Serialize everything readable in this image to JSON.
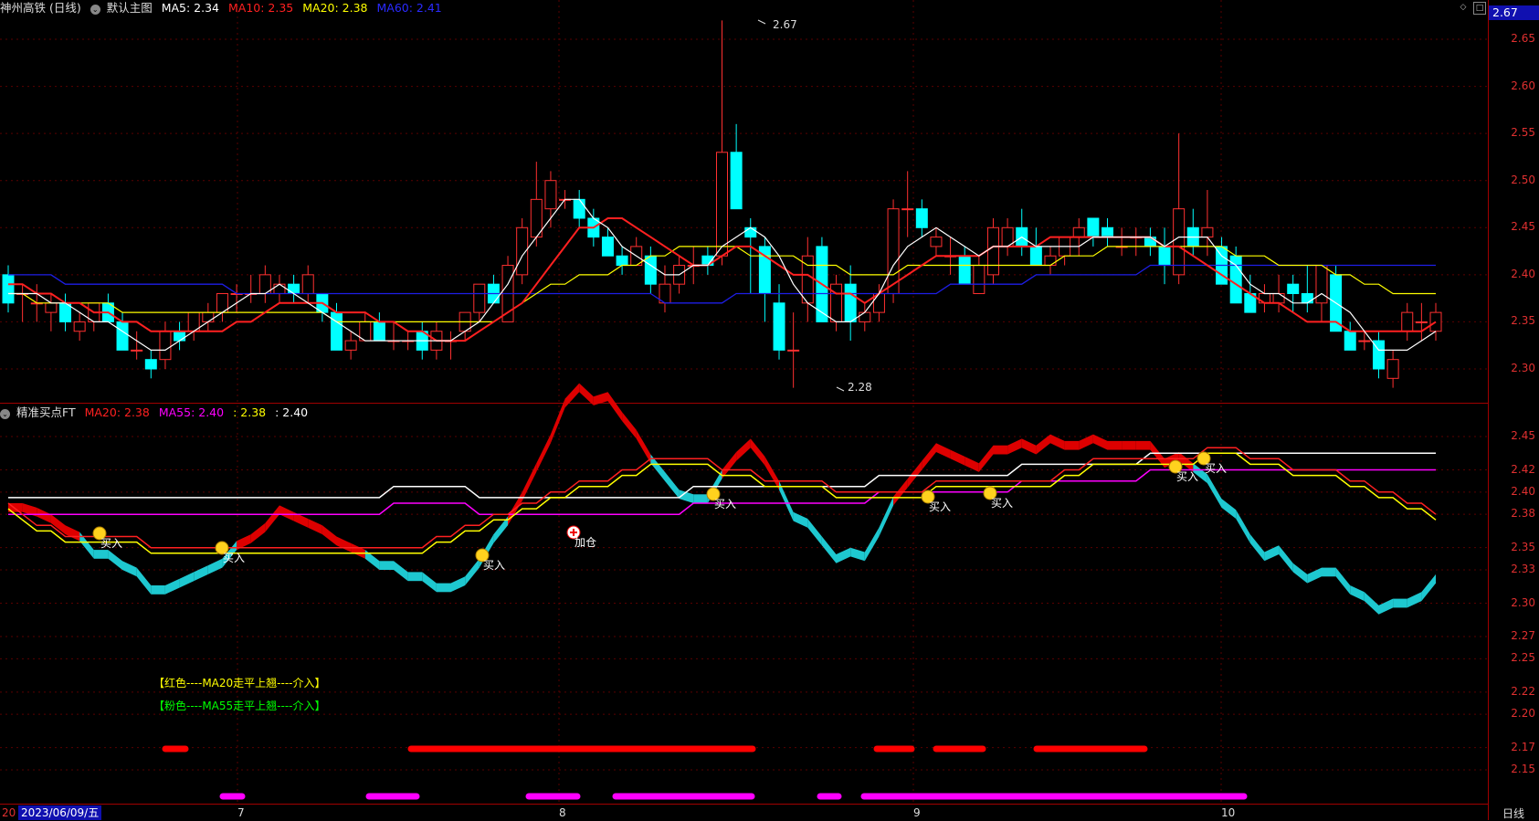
{
  "top_header": {
    "title": "神州高铁 (日线)",
    "main_chart_label": "默认主图",
    "ma5": "MA5: 2.34",
    "ma10": "MA10: 2.35",
    "ma20": "MA20: 2.38",
    "ma60": "MA60: 2.41"
  },
  "sub_header": {
    "title": "精准买点FT",
    "ma20": "MA20: 2.38",
    "ma55": "MA55: 2.40",
    "v3": ": 2.38",
    "v4": ": 2.40"
  },
  "current_price": "2.67",
  "main_axis": [
    "2.65",
    "2.60",
    "2.55",
    "2.50",
    "2.45",
    "2.40",
    "2.35",
    "2.30"
  ],
  "sub_axis": [
    "2.45",
    "2.42",
    "2.40",
    "2.38",
    "2.35",
    "2.33",
    "2.30",
    "2.27",
    "2.25",
    "2.22",
    "2.20",
    "2.17",
    "2.15"
  ],
  "high_marker": "2.67",
  "low_marker": "2.28",
  "signals": [
    "买入",
    "买入",
    "买入",
    "加仓",
    "买入",
    "买入",
    "买入",
    "买入",
    "买入"
  ],
  "legend": {
    "red": "【红色----MA20走平上翘----介入】",
    "pink": "【粉色----MA55走平上翘----介入】"
  },
  "x_axis": {
    "start": "20",
    "current_date": "2023/06/09/五",
    "months": [
      "7",
      "8",
      "9",
      "10"
    ],
    "period": "日线"
  },
  "colors": {
    "up_candle": "#ff3030",
    "down_candle": "#00ffff",
    "ma5": "#ffffff",
    "ma10": "#ff2020",
    "ma20": "#ffff00",
    "ma60": "#1e1ee6",
    "pink": "#ff00ff"
  },
  "chart_data": {
    "type": "candlestick",
    "ohlc": [
      [
        2.4,
        2.41,
        2.36,
        2.37
      ],
      [
        2.38,
        2.39,
        2.35,
        2.38
      ],
      [
        2.37,
        2.39,
        2.35,
        2.37
      ],
      [
        2.36,
        2.38,
        2.34,
        2.37
      ],
      [
        2.37,
        2.38,
        2.34,
        2.35
      ],
      [
        2.34,
        2.36,
        2.33,
        2.35
      ],
      [
        2.35,
        2.37,
        2.34,
        2.37
      ],
      [
        2.37,
        2.38,
        2.35,
        2.35
      ],
      [
        2.35,
        2.36,
        2.32,
        2.32
      ],
      [
        2.32,
        2.34,
        2.31,
        2.32
      ],
      [
        2.31,
        2.32,
        2.29,
        2.3
      ],
      [
        2.31,
        2.35,
        2.3,
        2.34
      ],
      [
        2.34,
        2.35,
        2.32,
        2.33
      ],
      [
        2.34,
        2.36,
        2.33,
        2.36
      ],
      [
        2.35,
        2.37,
        2.34,
        2.36
      ],
      [
        2.36,
        2.38,
        2.35,
        2.38
      ],
      [
        2.38,
        2.39,
        2.36,
        2.38
      ],
      [
        2.38,
        2.4,
        2.37,
        2.38
      ],
      [
        2.38,
        2.41,
        2.37,
        2.4
      ],
      [
        2.38,
        2.4,
        2.37,
        2.39
      ],
      [
        2.39,
        2.4,
        2.37,
        2.38
      ],
      [
        2.38,
        2.41,
        2.37,
        2.4
      ],
      [
        2.38,
        2.38,
        2.35,
        2.36
      ],
      [
        2.36,
        2.37,
        2.32,
        2.32
      ],
      [
        2.32,
        2.34,
        2.31,
        2.33
      ],
      [
        2.33,
        2.36,
        2.33,
        2.35
      ],
      [
        2.35,
        2.36,
        2.33,
        2.33
      ],
      [
        2.33,
        2.35,
        2.32,
        2.33
      ],
      [
        2.33,
        2.34,
        2.32,
        2.33
      ],
      [
        2.34,
        2.35,
        2.31,
        2.32
      ],
      [
        2.32,
        2.35,
        2.31,
        2.34
      ],
      [
        2.33,
        2.34,
        2.31,
        2.33
      ],
      [
        2.34,
        2.36,
        2.33,
        2.36
      ],
      [
        2.36,
        2.38,
        2.35,
        2.39
      ],
      [
        2.39,
        2.4,
        2.37,
        2.37
      ],
      [
        2.35,
        2.42,
        2.35,
        2.41
      ],
      [
        2.4,
        2.46,
        2.39,
        2.45
      ],
      [
        2.44,
        2.52,
        2.43,
        2.48
      ],
      [
        2.47,
        2.51,
        2.45,
        2.5
      ],
      [
        2.48,
        2.49,
        2.47,
        2.48
      ],
      [
        2.48,
        2.49,
        2.45,
        2.46
      ],
      [
        2.46,
        2.47,
        2.43,
        2.44
      ],
      [
        2.44,
        2.45,
        2.42,
        2.42
      ],
      [
        2.42,
        2.43,
        2.4,
        2.41
      ],
      [
        2.41,
        2.44,
        2.41,
        2.43
      ],
      [
        2.42,
        2.43,
        2.38,
        2.39
      ],
      [
        2.37,
        2.41,
        2.36,
        2.39
      ],
      [
        2.39,
        2.42,
        2.38,
        2.41
      ],
      [
        2.41,
        2.43,
        2.39,
        2.41
      ],
      [
        2.42,
        2.43,
        2.4,
        2.41
      ],
      [
        2.42,
        2.67,
        2.41,
        2.53
      ],
      [
        2.53,
        2.56,
        2.47,
        2.47
      ],
      [
        2.45,
        2.46,
        2.38,
        2.44
      ],
      [
        2.43,
        2.44,
        2.35,
        2.38
      ],
      [
        2.37,
        2.39,
        2.31,
        2.32
      ],
      [
        2.32,
        2.36,
        2.28,
        2.32
      ],
      [
        2.37,
        2.44,
        2.35,
        2.42
      ],
      [
        2.43,
        2.44,
        2.35,
        2.35
      ],
      [
        2.35,
        2.4,
        2.34,
        2.39
      ],
      [
        2.39,
        2.41,
        2.33,
        2.35
      ],
      [
        2.35,
        2.37,
        2.34,
        2.36
      ],
      [
        2.36,
        2.39,
        2.35,
        2.38
      ],
      [
        2.38,
        2.48,
        2.37,
        2.47
      ],
      [
        2.47,
        2.51,
        2.44,
        2.47
      ],
      [
        2.47,
        2.48,
        2.44,
        2.45
      ],
      [
        2.43,
        2.45,
        2.42,
        2.44
      ],
      [
        2.42,
        2.44,
        2.4,
        2.42
      ],
      [
        2.42,
        2.43,
        2.39,
        2.39
      ],
      [
        2.38,
        2.42,
        2.38,
        2.41
      ],
      [
        2.4,
        2.46,
        2.39,
        2.45
      ],
      [
        2.43,
        2.46,
        2.42,
        2.45
      ],
      [
        2.45,
        2.47,
        2.42,
        2.43
      ],
      [
        2.43,
        2.45,
        2.41,
        2.41
      ],
      [
        2.41,
        2.43,
        2.4,
        2.42
      ],
      [
        2.42,
        2.44,
        2.41,
        2.44
      ],
      [
        2.44,
        2.46,
        2.42,
        2.45
      ],
      [
        2.46,
        2.46,
        2.43,
        2.44
      ],
      [
        2.45,
        2.46,
        2.43,
        2.44
      ],
      [
        2.43,
        2.45,
        2.42,
        2.43
      ],
      [
        2.44,
        2.45,
        2.42,
        2.44
      ],
      [
        2.44,
        2.45,
        2.42,
        2.43
      ],
      [
        2.43,
        2.45,
        2.39,
        2.41
      ],
      [
        2.4,
        2.55,
        2.39,
        2.47
      ],
      [
        2.45,
        2.47,
        2.42,
        2.43
      ],
      [
        2.44,
        2.49,
        2.42,
        2.45
      ],
      [
        2.43,
        2.44,
        2.39,
        2.39
      ],
      [
        2.42,
        2.43,
        2.37,
        2.37
      ],
      [
        2.38,
        2.4,
        2.36,
        2.36
      ],
      [
        2.37,
        2.39,
        2.36,
        2.38
      ],
      [
        2.37,
        2.4,
        2.36,
        2.38
      ],
      [
        2.39,
        2.4,
        2.36,
        2.38
      ],
      [
        2.38,
        2.41,
        2.36,
        2.37
      ],
      [
        2.37,
        2.41,
        2.35,
        2.41
      ],
      [
        2.4,
        2.41,
        2.34,
        2.34
      ],
      [
        2.34,
        2.35,
        2.32,
        2.32
      ],
      [
        2.33,
        2.34,
        2.32,
        2.33
      ],
      [
        2.33,
        2.34,
        2.29,
        2.3
      ],
      [
        2.29,
        2.32,
        2.28,
        2.31
      ],
      [
        2.34,
        2.37,
        2.33,
        2.36
      ],
      [
        2.35,
        2.37,
        2.33,
        2.35
      ],
      [
        2.34,
        2.37,
        2.33,
        2.36
      ]
    ],
    "ma5": [
      2.38,
      2.38,
      2.38,
      2.37,
      2.37,
      2.36,
      2.35,
      2.35,
      2.34,
      2.33,
      2.32,
      2.32,
      2.33,
      2.34,
      2.35,
      2.36,
      2.37,
      2.38,
      2.38,
      2.39,
      2.38,
      2.37,
      2.36,
      2.35,
      2.34,
      2.33,
      2.33,
      2.33,
      2.33,
      2.33,
      2.33,
      2.33,
      2.34,
      2.35,
      2.37,
      2.39,
      2.42,
      2.44,
      2.46,
      2.48,
      2.48,
      2.46,
      2.45,
      2.43,
      2.42,
      2.41,
      2.4,
      2.4,
      2.41,
      2.41,
      2.43,
      2.44,
      2.45,
      2.44,
      2.42,
      2.39,
      2.37,
      2.36,
      2.35,
      2.35,
      2.36,
      2.38,
      2.41,
      2.43,
      2.44,
      2.45,
      2.44,
      2.43,
      2.42,
      2.43,
      2.43,
      2.44,
      2.43,
      2.43,
      2.43,
      2.43,
      2.44,
      2.44,
      2.44,
      2.44,
      2.44,
      2.43,
      2.44,
      2.44,
      2.44,
      2.42,
      2.41,
      2.39,
      2.38,
      2.38,
      2.37,
      2.37,
      2.38,
      2.37,
      2.36,
      2.34,
      2.32,
      2.32,
      2.32,
      2.33,
      2.34
    ],
    "ma10": [
      2.39,
      2.39,
      2.38,
      2.38,
      2.37,
      2.37,
      2.36,
      2.36,
      2.35,
      2.35,
      2.34,
      2.34,
      2.34,
      2.34,
      2.34,
      2.34,
      2.35,
      2.35,
      2.36,
      2.37,
      2.37,
      2.37,
      2.37,
      2.36,
      2.36,
      2.36,
      2.35,
      2.35,
      2.34,
      2.34,
      2.33,
      2.33,
      2.33,
      2.34,
      2.35,
      2.36,
      2.37,
      2.39,
      2.41,
      2.43,
      2.45,
      2.45,
      2.46,
      2.46,
      2.45,
      2.44,
      2.43,
      2.42,
      2.41,
      2.41,
      2.42,
      2.43,
      2.43,
      2.42,
      2.41,
      2.4,
      2.4,
      2.39,
      2.38,
      2.38,
      2.37,
      2.38,
      2.39,
      2.4,
      2.41,
      2.42,
      2.42,
      2.42,
      2.42,
      2.43,
      2.43,
      2.43,
      2.43,
      2.44,
      2.44,
      2.44,
      2.44,
      2.44,
      2.44,
      2.44,
      2.44,
      2.43,
      2.43,
      2.42,
      2.41,
      2.4,
      2.39,
      2.38,
      2.37,
      2.37,
      2.36,
      2.35,
      2.35,
      2.35,
      2.34,
      2.34,
      2.34,
      2.34,
      2.34,
      2.34,
      2.35
    ],
    "ma20": [
      2.38,
      2.38,
      2.37,
      2.37,
      2.37,
      2.37,
      2.37,
      2.37,
      2.36,
      2.36,
      2.36,
      2.36,
      2.36,
      2.36,
      2.36,
      2.36,
      2.36,
      2.36,
      2.36,
      2.36,
      2.36,
      2.36,
      2.36,
      2.35,
      2.35,
      2.35,
      2.35,
      2.35,
      2.35,
      2.35,
      2.35,
      2.35,
      2.35,
      2.35,
      2.35,
      2.36,
      2.37,
      2.38,
      2.39,
      2.39,
      2.4,
      2.4,
      2.4,
      2.41,
      2.41,
      2.42,
      2.42,
      2.43,
      2.43,
      2.43,
      2.43,
      2.43,
      2.42,
      2.42,
      2.42,
      2.42,
      2.41,
      2.41,
      2.41,
      2.4,
      2.4,
      2.4,
      2.4,
      2.41,
      2.41,
      2.41,
      2.41,
      2.41,
      2.41,
      2.41,
      2.41,
      2.41,
      2.41,
      2.41,
      2.42,
      2.42,
      2.42,
      2.43,
      2.43,
      2.43,
      2.43,
      2.43,
      2.43,
      2.43,
      2.43,
      2.43,
      2.42,
      2.42,
      2.42,
      2.41,
      2.41,
      2.41,
      2.41,
      2.4,
      2.4,
      2.39,
      2.39,
      2.38,
      2.38,
      2.38,
      2.38
    ],
    "ma60": [
      2.4,
      2.4,
      2.4,
      2.4,
      2.39,
      2.39,
      2.39,
      2.39,
      2.39,
      2.39,
      2.39,
      2.39,
      2.39,
      2.39,
      2.39,
      2.39,
      2.38,
      2.38,
      2.38,
      2.38,
      2.38,
      2.38,
      2.38,
      2.38,
      2.38,
      2.38,
      2.38,
      2.38,
      2.38,
      2.38,
      2.38,
      2.38,
      2.38,
      2.38,
      2.38,
      2.38,
      2.38,
      2.38,
      2.38,
      2.38,
      2.38,
      2.38,
      2.38,
      2.38,
      2.38,
      2.38,
      2.37,
      2.37,
      2.37,
      2.37,
      2.37,
      2.38,
      2.38,
      2.38,
      2.38,
      2.38,
      2.38,
      2.38,
      2.38,
      2.38,
      2.38,
      2.38,
      2.38,
      2.38,
      2.38,
      2.38,
      2.39,
      2.39,
      2.39,
      2.39,
      2.39,
      2.39,
      2.4,
      2.4,
      2.4,
      2.4,
      2.4,
      2.4,
      2.4,
      2.4,
      2.41,
      2.41,
      2.41,
      2.41,
      2.41,
      2.41,
      2.41,
      2.41,
      2.41,
      2.41,
      2.41,
      2.41,
      2.41,
      2.41,
      2.41,
      2.41,
      2.41,
      2.41,
      2.41,
      2.41,
      2.41
    ],
    "sub_ma20": [
      2.39,
      2.38,
      2.37,
      2.37,
      2.36,
      2.36,
      2.36,
      2.36,
      2.36,
      2.36,
      2.35,
      2.35,
      2.35,
      2.35,
      2.35,
      2.35,
      2.35,
      2.35,
      2.35,
      2.35,
      2.35,
      2.35,
      2.35,
      2.35,
      2.35,
      2.35,
      2.35,
      2.35,
      2.35,
      2.35,
      2.36,
      2.36,
      2.37,
      2.37,
      2.38,
      2.38,
      2.39,
      2.39,
      2.4,
      2.4,
      2.41,
      2.41,
      2.41,
      2.42,
      2.42,
      2.43,
      2.43,
      2.43,
      2.43,
      2.43,
      2.42,
      2.42,
      2.42,
      2.41,
      2.41,
      2.41,
      2.41,
      2.41,
      2.4,
      2.4,
      2.4,
      2.4,
      2.4,
      2.4,
      2.4,
      2.41,
      2.41,
      2.41,
      2.41,
      2.41,
      2.41,
      2.41,
      2.41,
      2.41,
      2.42,
      2.42,
      2.43,
      2.43,
      2.43,
      2.43,
      2.43,
      2.43,
      2.43,
      2.43,
      2.44,
      2.44,
      2.44,
      2.43,
      2.43,
      2.43,
      2.42,
      2.42,
      2.42,
      2.42,
      2.41,
      2.41,
      2.4,
      2.4,
      2.39,
      2.39,
      2.38
    ],
    "sub_ma55": [
      2.38,
      2.38,
      2.38,
      2.38,
      2.38,
      2.38,
      2.38,
      2.38,
      2.38,
      2.38,
      2.38,
      2.38,
      2.38,
      2.38,
      2.38,
      2.38,
      2.38,
      2.38,
      2.38,
      2.38,
      2.38,
      2.38,
      2.38,
      2.38,
      2.38,
      2.38,
      2.38,
      2.39,
      2.39,
      2.39,
      2.39,
      2.39,
      2.39,
      2.38,
      2.38,
      2.38,
      2.38,
      2.38,
      2.38,
      2.38,
      2.38,
      2.38,
      2.38,
      2.38,
      2.38,
      2.38,
      2.38,
      2.38,
      2.39,
      2.39,
      2.39,
      2.39,
      2.39,
      2.39,
      2.39,
      2.39,
      2.39,
      2.39,
      2.39,
      2.39,
      2.39,
      2.4,
      2.4,
      2.4,
      2.4,
      2.4,
      2.4,
      2.4,
      2.4,
      2.4,
      2.4,
      2.41,
      2.41,
      2.41,
      2.41,
      2.41,
      2.41,
      2.41,
      2.41,
      2.41,
      2.42,
      2.42,
      2.42,
      2.42,
      2.42,
      2.42,
      2.42,
      2.42,
      2.42,
      2.42,
      2.42,
      2.42,
      2.42,
      2.42,
      2.42,
      2.42,
      2.42,
      2.42,
      2.42,
      2.42,
      2.42
    ]
  }
}
